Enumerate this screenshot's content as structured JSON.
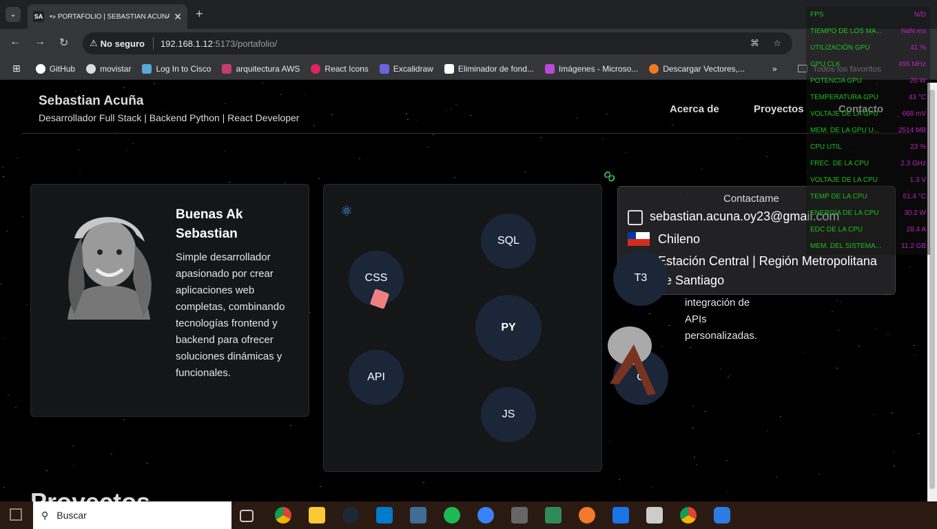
{
  "browser": {
    "tab_title": "•» PORTAFOLIO | SEBASTIAN ACUNA",
    "tab_favicon": "SA",
    "security_label": "No seguro",
    "url_host": "192.168.1.12",
    "url_rest": ":5173/portafolio/",
    "bookmarks": [
      "GitHub",
      "movistar",
      "Log In to Cisco",
      "arquitectura AWS",
      "React Icons",
      "Excalidraw",
      "Eliminador de fond...",
      "Imágenes - Microso...",
      "Descargar Vectores,..."
    ],
    "all_bookmarks": "Todos los favoritos"
  },
  "site": {
    "name": "Sebastian Acuña",
    "tagline": "Desarrollador Full Stack | Backend Python | React Developer",
    "nav": [
      "Acerca de",
      "Proyectos",
      "Contacto"
    ],
    "greeting_line1": "Buenas Ak",
    "greeting_line2": "Sebastian",
    "bio": "Simple desarrollador apasionado por crear aplicaciones web completas, combinando tecnologías frontend y backend para ofrecer soluciones dinámicas y funcionales.",
    "skills": [
      "SQL",
      "CSS",
      "PY",
      "API",
      "JS",
      "T3",
      "C"
    ],
    "contact_title": "Contactame",
    "email": "sebastian.acuna.oy23@gmail.com",
    "nationality": "Chileno",
    "location_line1": "Estación Central | Región Metropolitana",
    "location_line2": "de Santiago",
    "extra_text": "integración de APIs personalizadas.",
    "section_heading": "Proyectos"
  },
  "hud": [
    {
      "label": "FPS",
      "value": "N/D"
    },
    {
      "label": "TIEMPO DE LOS MA...",
      "value": "NaN ms"
    },
    {
      "label": "UTILIZACIÓN GPU",
      "value": "41 %"
    },
    {
      "label": "GPU CLK",
      "value": "496 MHz"
    },
    {
      "label": "POTENCIA GPU",
      "value": "20 W"
    },
    {
      "label": "TEMPERATURA GPU",
      "value": "43 °C"
    },
    {
      "label": "VOLTAJE DE LA GPU",
      "value": "668 mV"
    },
    {
      "label": "MEM. DE LA GPU U...",
      "value": "2514 MB"
    },
    {
      "label": "CPU UTIL",
      "value": "23 %"
    },
    {
      "label": "FREC. DE LA CPU",
      "value": "2.3 GHz"
    },
    {
      "label": "VOLTAJE DE LA CPU",
      "value": "1.3 V"
    },
    {
      "label": "TEMP DE LA CPU",
      "value": "51.4 °C"
    },
    {
      "label": "ENERGÍA DE LA CPU",
      "value": "30.2 W"
    },
    {
      "label": "EDC DE LA CPU",
      "value": "28.4 A"
    },
    {
      "label": "MEM. DEL SISTEMA...",
      "value": "11.2 GB"
    }
  ],
  "taskbar": {
    "search_placeholder": "Buscar"
  },
  "colors": {
    "page_bg": "#000000",
    "card_bg": "#151618",
    "bubble_bg": "#1b2639",
    "hud_label": "#1cc21c",
    "hud_value": "#c020c0"
  }
}
